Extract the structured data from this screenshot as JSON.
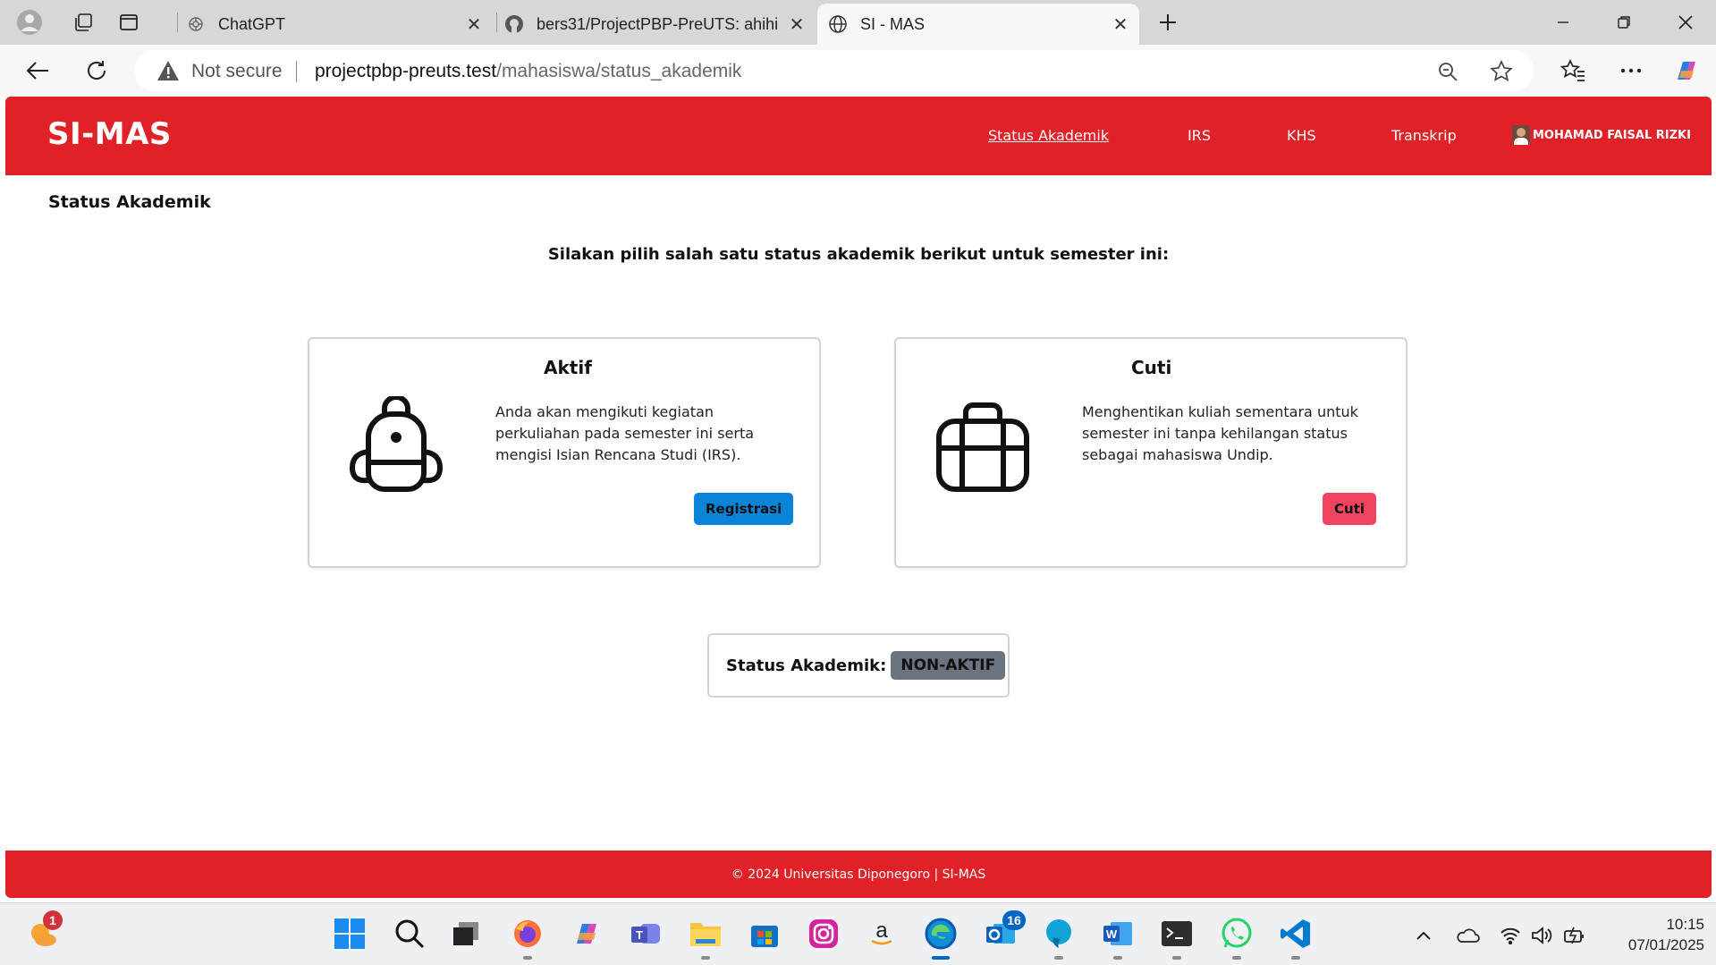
{
  "browser": {
    "tabs": [
      {
        "title": "ChatGPT",
        "icon": "chatgpt-icon"
      },
      {
        "title": "bers31/ProjectPBP-PreUTS: ahihi",
        "icon": "github-icon"
      },
      {
        "title": "SI - MAS",
        "icon": "globe-icon",
        "active": true
      }
    ],
    "security_label": "Not secure",
    "url_host": "projectpbp-preuts.test",
    "url_path": "/mahasiswa/status_akademik"
  },
  "app": {
    "brand": "SI-MAS",
    "menu": [
      {
        "label": "Status Akademik",
        "active": true
      },
      {
        "label": "IRS"
      },
      {
        "label": "KHS"
      },
      {
        "label": "Transkrip"
      }
    ],
    "user_name": "MOHAMAD FAISAL RIZKI",
    "page_title": "Status Akademik",
    "prompt": "Silakan pilih salah satu status akademik berikut untuk semester ini:",
    "cards": [
      {
        "title": "Aktif",
        "icon": "backpack-icon",
        "description": "Anda akan mengikuti kegiatan perkuliahan pada semester ini serta mengisi Isian Rencana Studi (IRS).",
        "button": "Registrasi",
        "button_color": "#0a84d8"
      },
      {
        "title": "Cuti",
        "icon": "briefcase-icon",
        "description": "Menghentikan kuliah sementara untuk semester ini tanpa kehilangan status sebagai mahasiswa Undip.",
        "button": "Cuti",
        "button_color": "#f0435f"
      }
    ],
    "status_label": "Status Akademik:",
    "status_value": "NON-AKTIF",
    "footer": "© 2024 Universitas Diponegoro | SI-MAS",
    "colors": {
      "primary": "#e02127",
      "status_badge": "#6b7280"
    }
  },
  "taskbar": {
    "notification_badge": "1",
    "outlook_badge": "16",
    "time": "10:15",
    "date": "07/01/2025"
  }
}
